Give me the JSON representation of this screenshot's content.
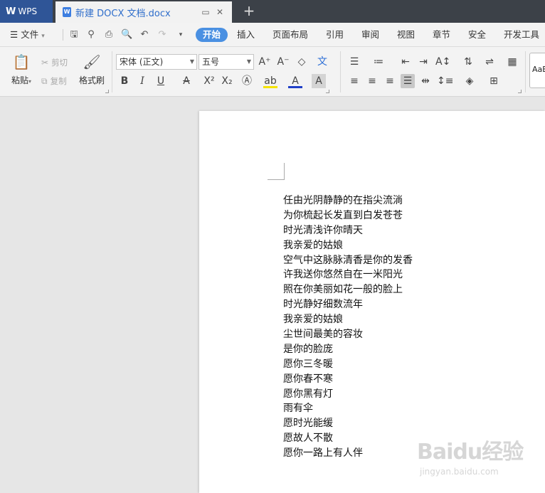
{
  "titlebar": {
    "app_name": "WPS",
    "doc_title": "新建 DOCX 文档.docx",
    "new_tab_symbol": "+"
  },
  "menubar": {
    "file_label": "文件",
    "tabs": [
      "开始",
      "插入",
      "页面布局",
      "引用",
      "审阅",
      "视图",
      "章节",
      "安全",
      "开发工具"
    ],
    "active_tab": "开始"
  },
  "ribbon": {
    "paste_label": "粘贴",
    "cut_label": "剪切",
    "copy_label": "复制",
    "format_painter_label": "格式刷",
    "font_name": "宋体 (正文)",
    "font_size": "五号",
    "style_preview": "AaBb"
  },
  "document": {
    "lines": [
      "任由光阴静静的在指尖流淌",
      "为你梳起长发直到白发苍苍",
      "时光清浅许你晴天",
      "我亲爱的姑娘",
      "空气中这脉脉清香是你的发香",
      "许我送你悠然自在一米阳光",
      "照在你美丽如花一般的脸上",
      "时光静好细数流年",
      "我亲爱的姑娘",
      "尘世间最美的容妆",
      "是你的脸庞",
      "愿你三冬暖",
      "愿你春不寒",
      "愿你黑有灯",
      "雨有伞",
      "愿时光能缓",
      "愿故人不散",
      "愿你一路上有人伴"
    ]
  },
  "watermark": {
    "main": "Baidu经验",
    "sub": "jingyan.baidu.com"
  },
  "colors": {
    "titlebar_bg": "#3c4148",
    "wps_tab_bg": "#2f5597",
    "active_tab_bg": "#4a90e2",
    "doc_title_color": "#2f6ecb"
  }
}
